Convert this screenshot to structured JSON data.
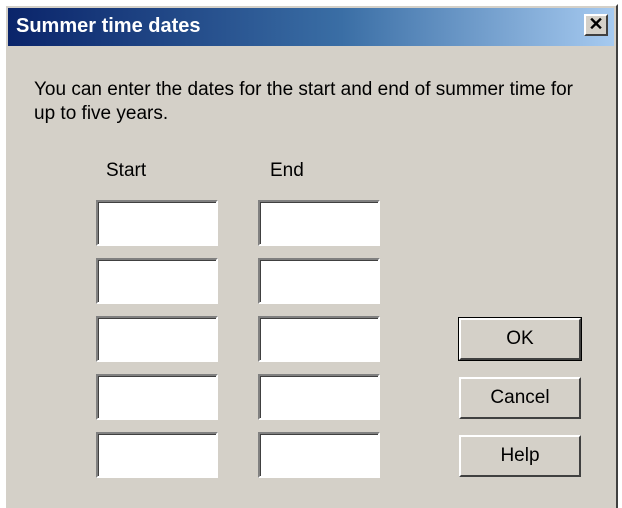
{
  "dialog": {
    "title": "Summer time dates",
    "close_glyph": "✕",
    "instructions": "You can enter the dates for the start and end of summer time for up to five years."
  },
  "columns": {
    "start_label": "Start",
    "end_label": "End"
  },
  "rows": [
    {
      "start": "",
      "end": ""
    },
    {
      "start": "",
      "end": ""
    },
    {
      "start": "",
      "end": ""
    },
    {
      "start": "",
      "end": ""
    },
    {
      "start": "",
      "end": ""
    }
  ],
  "buttons": {
    "ok": "OK",
    "cancel": "Cancel",
    "help": "Help"
  },
  "colors": {
    "titlebar_start": "#0a246a",
    "titlebar_end": "#a6caf0",
    "face": "#d4d0c8"
  }
}
